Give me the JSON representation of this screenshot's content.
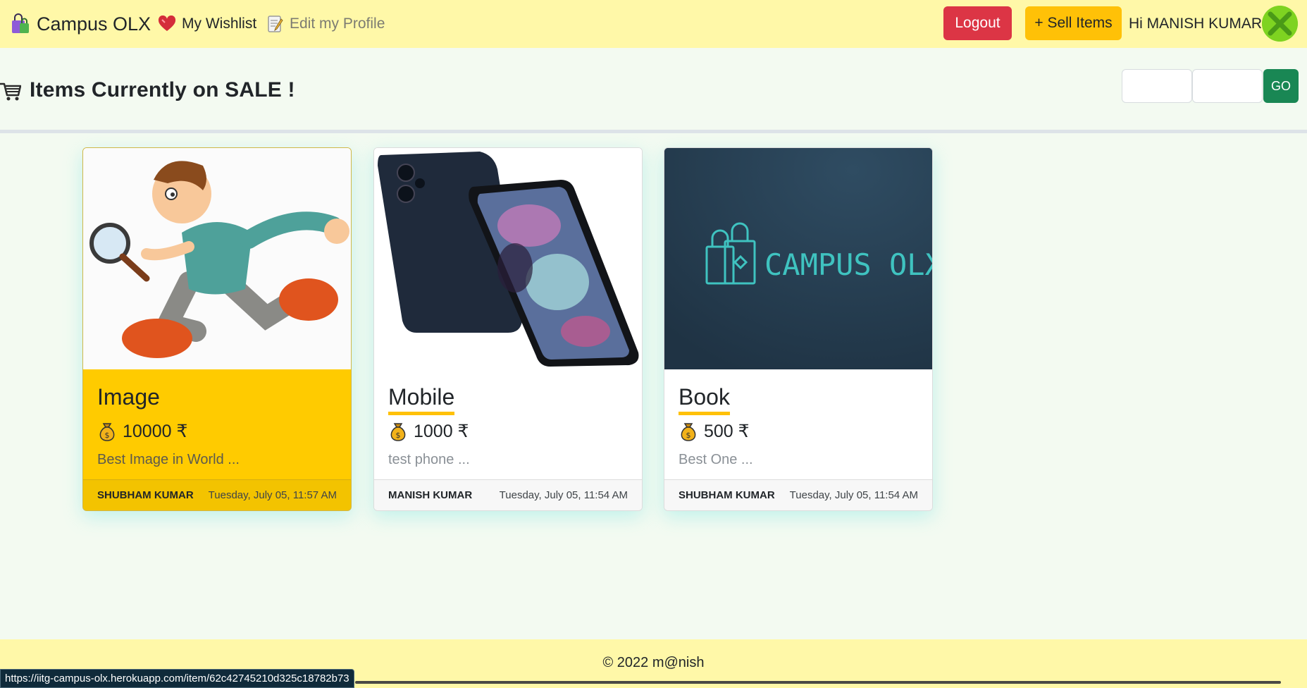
{
  "navbar": {
    "brand": "Campus OLX",
    "wishlist_label": "My Wishlist",
    "profile_label": "Edit my Profile",
    "logout_label": "Logout",
    "sell_label": "+ Sell Items",
    "greeting": "Hi MANISH KUMAR !"
  },
  "main": {
    "title": "Items Currently on SALE !",
    "search_a_value": "",
    "search_b_value": "",
    "go_label": "GO"
  },
  "items": [
    {
      "title": "Image",
      "price": "10000 ₹",
      "description": "Best Image in World ...",
      "seller": "SHUBHAM KUMAR",
      "date": "Tuesday, July 05, 11:57 AM"
    },
    {
      "title": "Mobile",
      "price": "1000 ₹",
      "description": "test phone ...",
      "seller": "MANISH KUMAR",
      "date": "Tuesday, July 05, 11:54 AM"
    },
    {
      "title": "Book",
      "price": "500 ₹",
      "description": "Best One ...",
      "seller": "SHUBHAM KUMAR",
      "date": "Tuesday, July 05, 11:54 AM",
      "image_text": "CAMPUS OLX"
    }
  ],
  "footer": {
    "copyright": "© 2022 m@nish"
  },
  "status_bar": {
    "url": "https://iitg-campus-olx.herokuapp.com/item/62c42745210d325c18782b73"
  },
  "colors": {
    "navbar_bg": "#fff8a8",
    "logout": "#dc3545",
    "sell": "#ffc107",
    "go": "#198754",
    "highlight_card": "#ffcb00"
  }
}
